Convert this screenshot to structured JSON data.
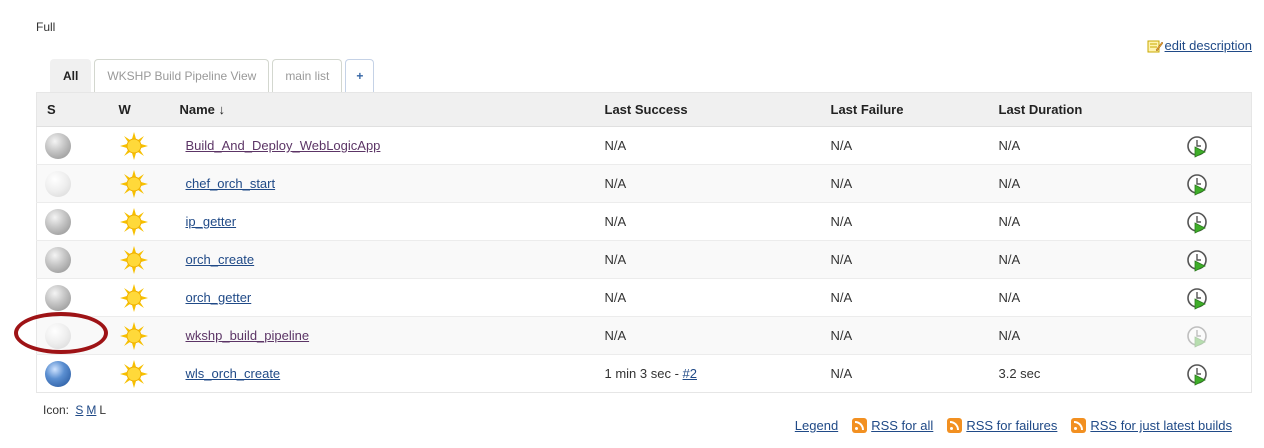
{
  "view": {
    "description": "Full",
    "edit_description_label": "edit description"
  },
  "tabs": [
    {
      "label": "All",
      "active": true
    },
    {
      "label": "WKSHP Build Pipeline View",
      "active": false
    },
    {
      "label": "main list",
      "active": false
    },
    {
      "label": "+",
      "active": false
    }
  ],
  "table": {
    "headers": {
      "status": "S",
      "weather": "W",
      "name": "Name ↓",
      "last_success": "Last Success",
      "last_failure": "Last Failure",
      "last_duration": "Last Duration"
    },
    "rows": [
      {
        "status": "grey",
        "weather": "sunny",
        "name": "Build_And_Deploy_WebLogicApp",
        "last_success": "N/A",
        "last_failure": "N/A",
        "last_duration": "N/A"
      },
      {
        "status": "disabled",
        "weather": "sunny",
        "name": "chef_orch_start",
        "last_success": "N/A",
        "last_failure": "N/A",
        "last_duration": "N/A"
      },
      {
        "status": "grey",
        "weather": "sunny",
        "name": "ip_getter",
        "last_success": "N/A",
        "last_failure": "N/A",
        "last_duration": "N/A"
      },
      {
        "status": "grey",
        "weather": "sunny",
        "name": "orch_create",
        "last_success": "N/A",
        "last_failure": "N/A",
        "last_duration": "N/A"
      },
      {
        "status": "grey",
        "weather": "sunny",
        "name": "orch_getter",
        "last_success": "N/A",
        "last_failure": "N/A",
        "last_duration": "N/A"
      },
      {
        "status": "disabled",
        "weather": "sunny",
        "name": "wkshp_build_pipeline",
        "last_success": "N/A",
        "last_failure": "N/A",
        "last_duration": "N/A"
      },
      {
        "status": "blue",
        "weather": "sunny",
        "name": "wls_orch_create",
        "last_success": "1 min 3 sec - ",
        "last_success_build": "#2",
        "last_failure": "N/A",
        "last_duration": "3.2 sec"
      }
    ]
  },
  "icon_size": {
    "label": "Icon:",
    "small": "S",
    "medium": "M",
    "large": "L"
  },
  "footer": {
    "legend": "Legend",
    "rss_all": "RSS for all",
    "rss_failures": "RSS for failures",
    "rss_latest": "RSS for just latest builds"
  },
  "colors": {
    "link": "#204a87",
    "visited_link": "#5c3566",
    "annotation_circle": "#9e1316",
    "header_bg": "#f0f0f0"
  }
}
